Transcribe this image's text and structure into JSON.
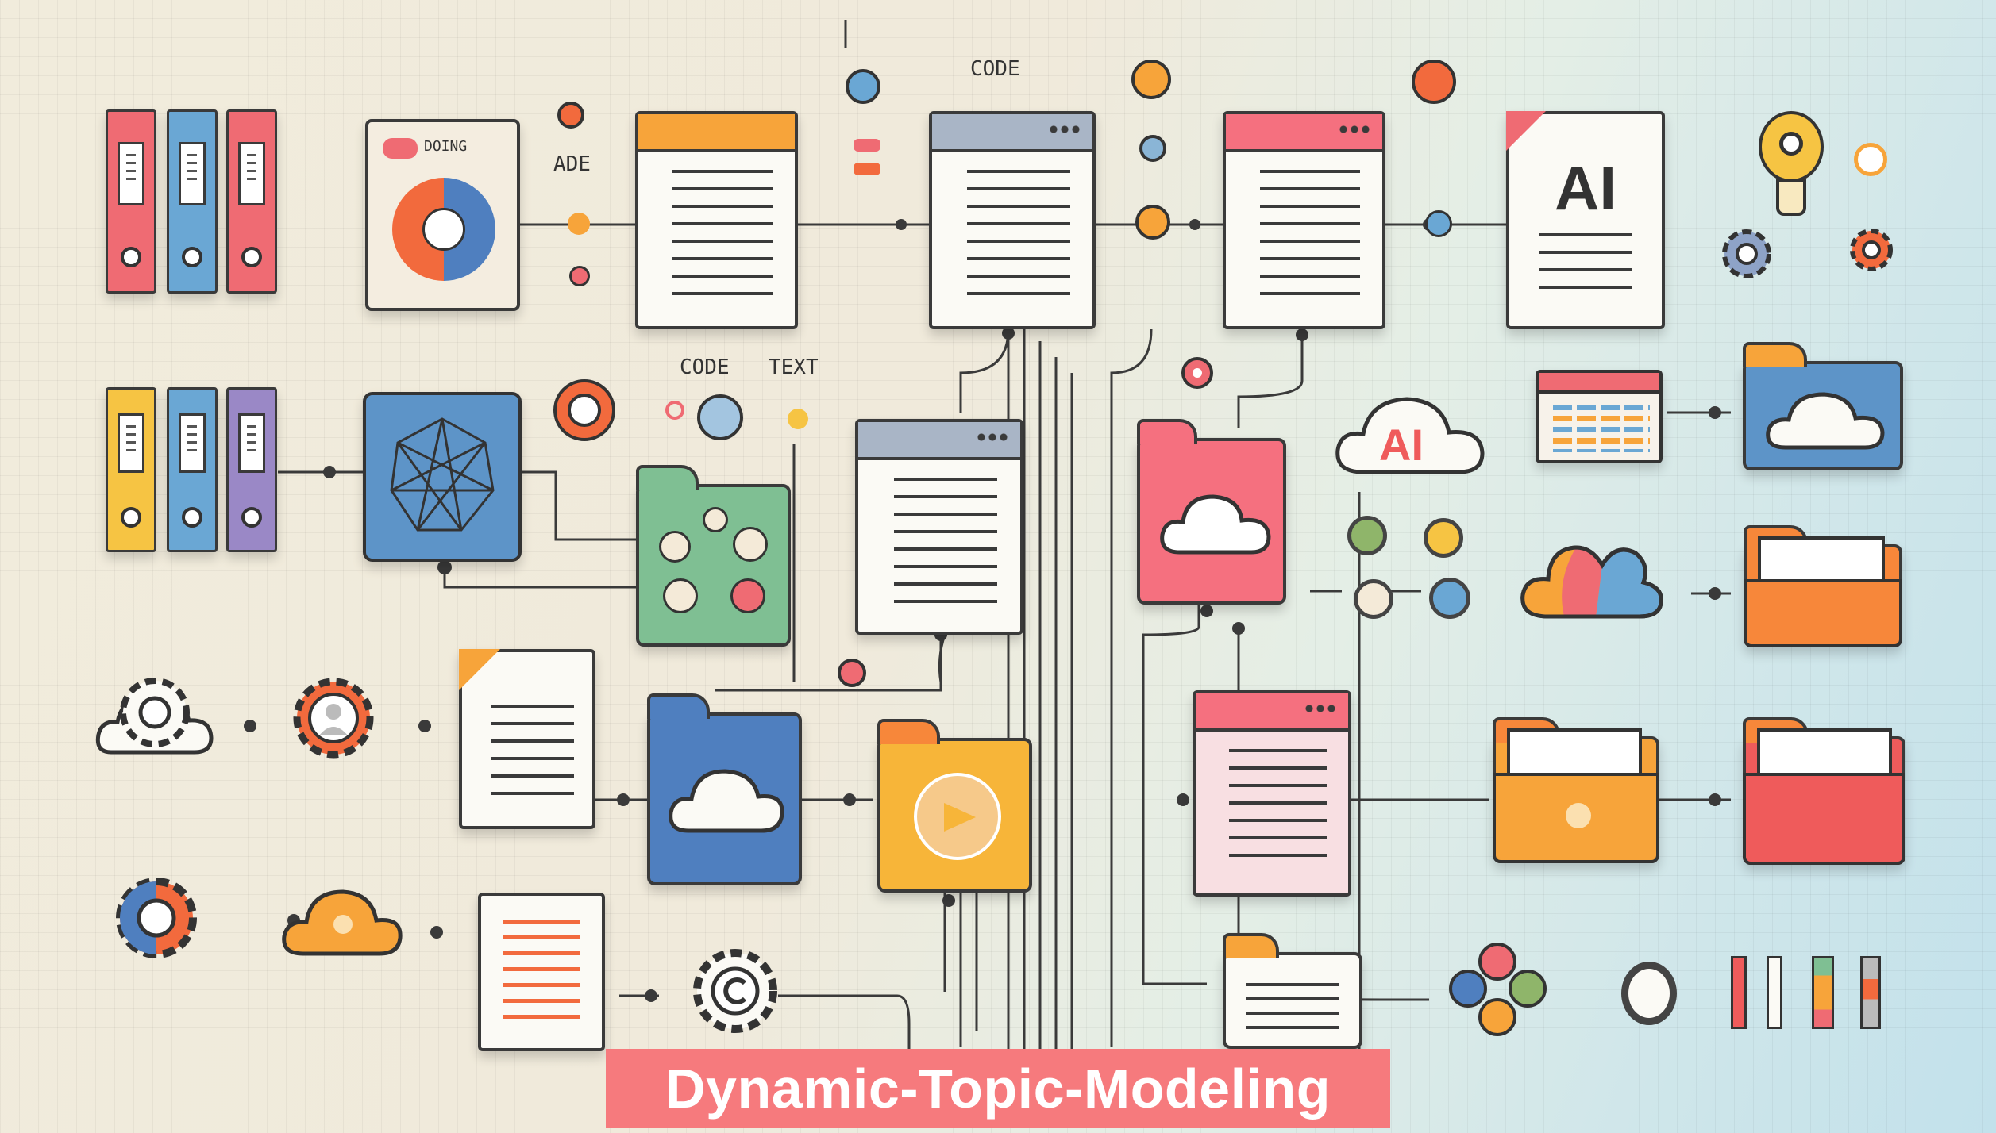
{
  "title": "Dynamic-Topic-Modeling",
  "labels": {
    "code_top": "CODE",
    "ade": "ADE",
    "doing": "DOING",
    "code_mid": "CODE",
    "text_mid": "TEXT",
    "ai_doc": "AI",
    "ai_cloud": "AI"
  },
  "colors": {
    "red": "#ef6b73",
    "blue": "#6aa7d4",
    "orange": "#f7a43a",
    "yellow": "#f6c443",
    "purple": "#9a88c6",
    "green": "#7fbf93",
    "pink": "#f5707f",
    "navy": "#4f7fbf",
    "banner": "#f67a7d"
  },
  "icons": [
    "binder-icon",
    "document-icon",
    "folder-icon",
    "cloud-icon",
    "gear-icon",
    "lightbulb-icon",
    "network-icon",
    "pie-chart-icon",
    "calendar-icon"
  ]
}
